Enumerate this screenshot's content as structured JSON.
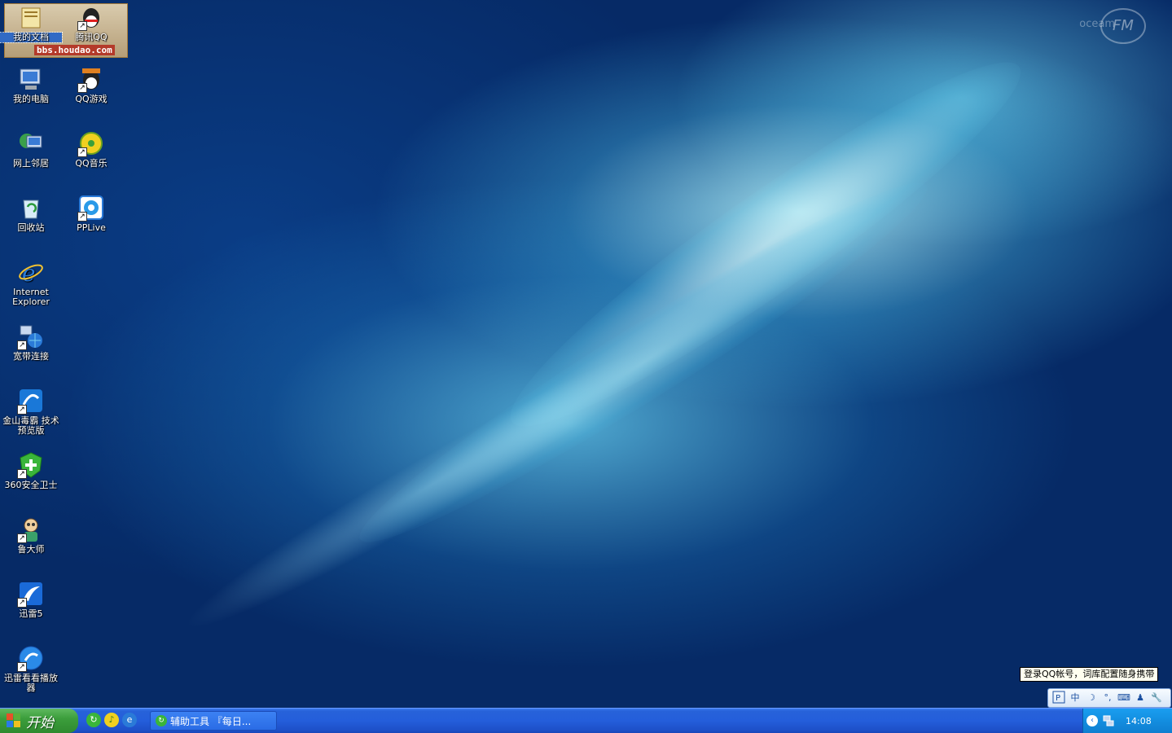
{
  "desktop": {
    "watermark_url": "bbs.houdao.com",
    "icons": [
      {
        "label": "我的文档",
        "icon": "my-documents-icon",
        "shortcut": false,
        "selected": true
      },
      {
        "label": "腾讯QQ",
        "icon": "qq-icon",
        "shortcut": true
      },
      {
        "label": "我的电脑",
        "icon": "my-computer-icon",
        "shortcut": false
      },
      {
        "label": "QQ游戏",
        "icon": "qq-game-icon",
        "shortcut": true
      },
      {
        "label": "网上邻居",
        "icon": "network-places-icon",
        "shortcut": false
      },
      {
        "label": "QQ音乐",
        "icon": "qq-music-icon",
        "shortcut": true
      },
      {
        "label": "回收站",
        "icon": "recycle-bin-icon",
        "shortcut": false
      },
      {
        "label": "PPLive",
        "icon": "pplive-icon",
        "shortcut": true
      },
      {
        "label": "Internet Explorer",
        "icon": "internet-explorer-icon",
        "shortcut": false
      },
      {
        "label": "宽带连接",
        "icon": "broadband-connection-icon",
        "shortcut": true
      },
      {
        "label": "金山毒霸 技术预览版",
        "icon": "kingsoft-antivirus-icon",
        "shortcut": true
      },
      {
        "label": "360安全卫士",
        "icon": "360-safe-icon",
        "shortcut": true
      },
      {
        "label": "鲁大师",
        "icon": "ludashi-icon",
        "shortcut": true
      },
      {
        "label": "迅雷5",
        "icon": "thunder-icon",
        "shortcut": true
      },
      {
        "label": "迅雷看看播放器",
        "icon": "xunlei-kankan-icon",
        "shortcut": true
      }
    ]
  },
  "ime": {
    "tooltip": "登录QQ帐号，词库配置随身携带",
    "mode_label": "中",
    "buttons": [
      "ime-logo-icon",
      "中",
      "moon-icon",
      "punctuation-icon",
      "keyboard-icon",
      "user-icon",
      "wrench-icon"
    ]
  },
  "taskbar": {
    "start_label": "开始",
    "task_label": "辅助工具 『每日...",
    "clock": "14:08"
  },
  "colors": {
    "taskbar_blue": "#245edb",
    "start_green": "#3c9e3c",
    "tray_blue": "#138ee0"
  }
}
